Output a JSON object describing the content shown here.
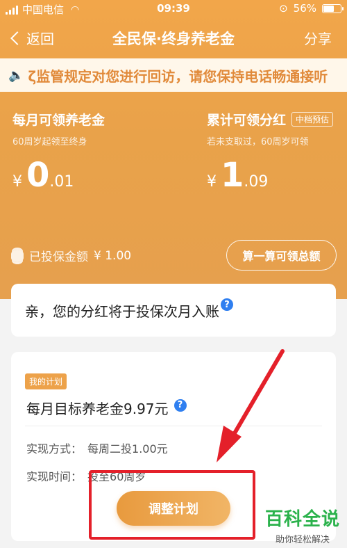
{
  "status_bar": {
    "carrier": "中国电信",
    "time": "09:39",
    "battery": "56%"
  },
  "nav": {
    "back_label": "返回",
    "title": "全民保·终身养老金",
    "share_label": "分享"
  },
  "notice": {
    "text": "ζ监管规定对您进行回访，请您保持电话畅通接听"
  },
  "summary": {
    "monthly": {
      "label": "每月可领养老金",
      "sub": "60周岁起领至终身",
      "currency": "¥",
      "int": "0",
      "dec": ".01"
    },
    "dividend": {
      "label": "累计可领分红",
      "badge": "中档预估",
      "sub": "若未支取过，60周岁可领",
      "currency": "¥",
      "int": "1",
      "dec": ".09"
    },
    "paid_label": "已投保金额",
    "paid_value": "¥ 1.00",
    "calc_button": "算一算可领总额"
  },
  "dividend_card": {
    "text": "亲，您的分红将于投保次月入账",
    "help": "?"
  },
  "plan": {
    "badge": "我的计划",
    "target": "每月目标养老金9.97元",
    "help": "?",
    "method_label": "实现方式：",
    "method_value": "每周二投1.00元",
    "time_label": "实现时间：",
    "time_value": "投至60周岁",
    "adjust_button": "调整计划"
  },
  "watermark": {
    "big": "百科全说",
    "small": "助你轻松解决"
  },
  "colors": {
    "accent": "#eda24a",
    "highlight": "#e4202a",
    "notice_text": "#e18a3a",
    "help": "#2f7ff0"
  }
}
